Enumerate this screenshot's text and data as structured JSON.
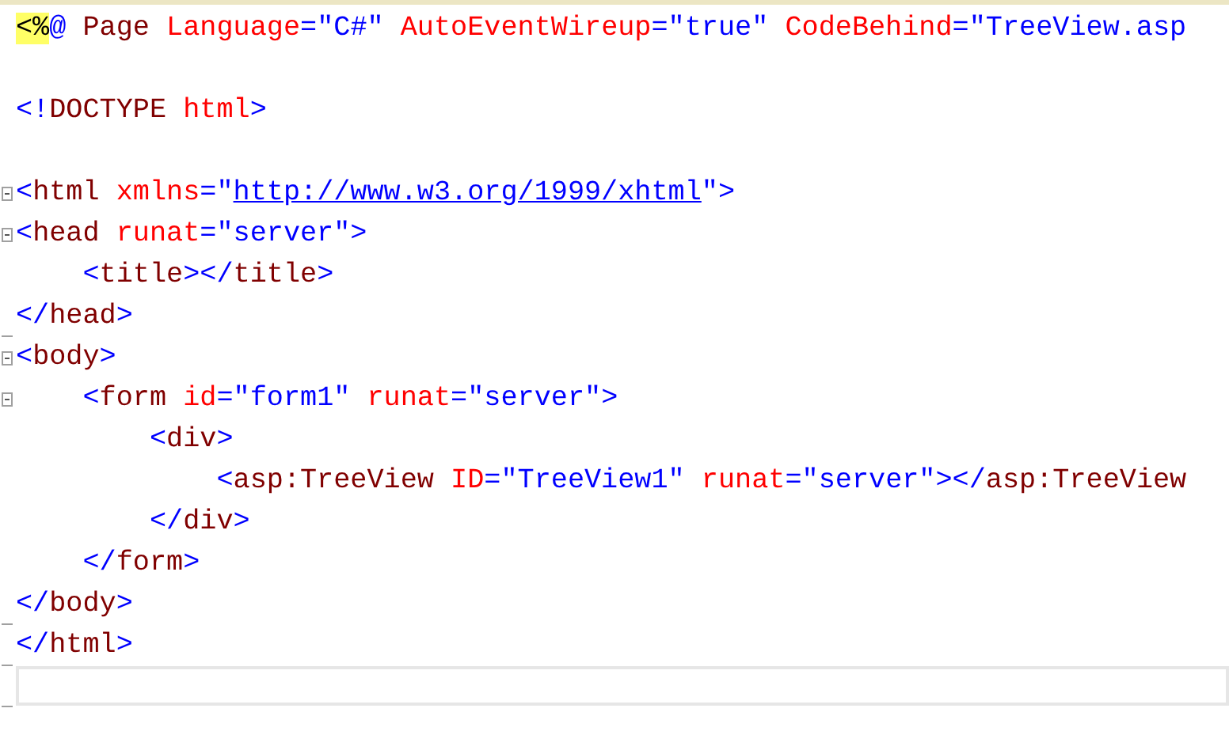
{
  "editor": {
    "lines": [
      {
        "fold_start": false,
        "fold_end": false,
        "current": false,
        "segments": [
          {
            "kind": "directive",
            "text": "<%"
          },
          {
            "kind": "delim",
            "text": "@"
          },
          {
            "kind": "element",
            "text": " Page"
          },
          {
            "kind": "attr",
            "text": " Language"
          },
          {
            "kind": "delim",
            "text": "=\"C#\""
          },
          {
            "kind": "attr",
            "text": " AutoEventWireup"
          },
          {
            "kind": "delim",
            "text": "=\"true\""
          },
          {
            "kind": "attr",
            "text": " CodeBehind"
          },
          {
            "kind": "delim",
            "text": "=\"TreeView.asp"
          }
        ]
      },
      {
        "fold_start": false,
        "fold_end": false,
        "current": false
      },
      {
        "fold_start": false,
        "fold_end": false,
        "current": false,
        "segments": [
          {
            "kind": "delim",
            "text": "<!"
          },
          {
            "kind": "element",
            "text": "DOCTYPE"
          },
          {
            "kind": "attr",
            "text": " html"
          },
          {
            "kind": "delim",
            "text": ">"
          }
        ]
      },
      {
        "fold_start": false,
        "fold_end": false,
        "current": false
      },
      {
        "fold_start": true,
        "fold_end": false,
        "current": false,
        "segments": [
          {
            "kind": "delim",
            "text": "<"
          },
          {
            "kind": "element",
            "text": "html"
          },
          {
            "kind": "attr",
            "text": " xmlns"
          },
          {
            "kind": "delim",
            "text": "=\""
          },
          {
            "kind": "link",
            "text": "http://www.w3.org/1999/xhtml"
          },
          {
            "kind": "delim",
            "text": "\">"
          }
        ]
      },
      {
        "fold_start": true,
        "fold_end": false,
        "current": false,
        "segments": [
          {
            "kind": "delim",
            "text": "<"
          },
          {
            "kind": "element",
            "text": "head"
          },
          {
            "kind": "attr",
            "text": " runat"
          },
          {
            "kind": "delim",
            "text": "=\"server\">"
          }
        ]
      },
      {
        "fold_start": false,
        "fold_end": false,
        "current": false,
        "segments": [
          {
            "kind": "delim",
            "text": "    <"
          },
          {
            "kind": "element",
            "text": "title"
          },
          {
            "kind": "delim",
            "text": "></"
          },
          {
            "kind": "element",
            "text": "title"
          },
          {
            "kind": "delim",
            "text": ">"
          }
        ]
      },
      {
        "fold_start": false,
        "fold_end": true,
        "current": false,
        "segments": [
          {
            "kind": "delim",
            "text": "</"
          },
          {
            "kind": "element",
            "text": "head"
          },
          {
            "kind": "delim",
            "text": ">"
          }
        ]
      },
      {
        "fold_start": true,
        "fold_end": false,
        "current": false,
        "segments": [
          {
            "kind": "delim",
            "text": "<"
          },
          {
            "kind": "element",
            "text": "body"
          },
          {
            "kind": "delim",
            "text": ">"
          }
        ]
      },
      {
        "fold_start": true,
        "fold_end": false,
        "current": false,
        "segments": [
          {
            "kind": "delim",
            "text": "    <"
          },
          {
            "kind": "element",
            "text": "form"
          },
          {
            "kind": "attr",
            "text": " id"
          },
          {
            "kind": "delim",
            "text": "=\"form1\""
          },
          {
            "kind": "attr",
            "text": " runat"
          },
          {
            "kind": "delim",
            "text": "=\"server\">"
          }
        ]
      },
      {
        "fold_start": false,
        "fold_end": false,
        "current": false,
        "segments": [
          {
            "kind": "delim",
            "text": "        <"
          },
          {
            "kind": "element",
            "text": "div"
          },
          {
            "kind": "delim",
            "text": ">"
          }
        ]
      },
      {
        "fold_start": false,
        "fold_end": false,
        "current": false,
        "segments": [
          {
            "kind": "delim",
            "text": "            <"
          },
          {
            "kind": "element",
            "text": "asp:TreeView"
          },
          {
            "kind": "attr",
            "text": " ID"
          },
          {
            "kind": "delim",
            "text": "=\"TreeView1\""
          },
          {
            "kind": "attr",
            "text": " runat"
          },
          {
            "kind": "delim",
            "text": "=\"server\"></"
          },
          {
            "kind": "element",
            "text": "asp:TreeView"
          }
        ]
      },
      {
        "fold_start": false,
        "fold_end": false,
        "current": false,
        "segments": [
          {
            "kind": "delim",
            "text": "        </"
          },
          {
            "kind": "element",
            "text": "div"
          },
          {
            "kind": "delim",
            "text": ">"
          }
        ]
      },
      {
        "fold_start": false,
        "fold_end": false,
        "current": false,
        "segments": [
          {
            "kind": "delim",
            "text": "    </"
          },
          {
            "kind": "element",
            "text": "form"
          },
          {
            "kind": "delim",
            "text": ">"
          }
        ]
      },
      {
        "fold_start": false,
        "fold_end": true,
        "current": false,
        "segments": [
          {
            "kind": "delim",
            "text": "</"
          },
          {
            "kind": "element",
            "text": "body"
          },
          {
            "kind": "delim",
            "text": ">"
          }
        ]
      },
      {
        "fold_start": false,
        "fold_end": true,
        "current": false,
        "segments": [
          {
            "kind": "delim",
            "text": "</"
          },
          {
            "kind": "element",
            "text": "html"
          },
          {
            "kind": "delim",
            "text": ">"
          }
        ]
      },
      {
        "fold_start": false,
        "fold_end": true,
        "current": true
      }
    ]
  }
}
